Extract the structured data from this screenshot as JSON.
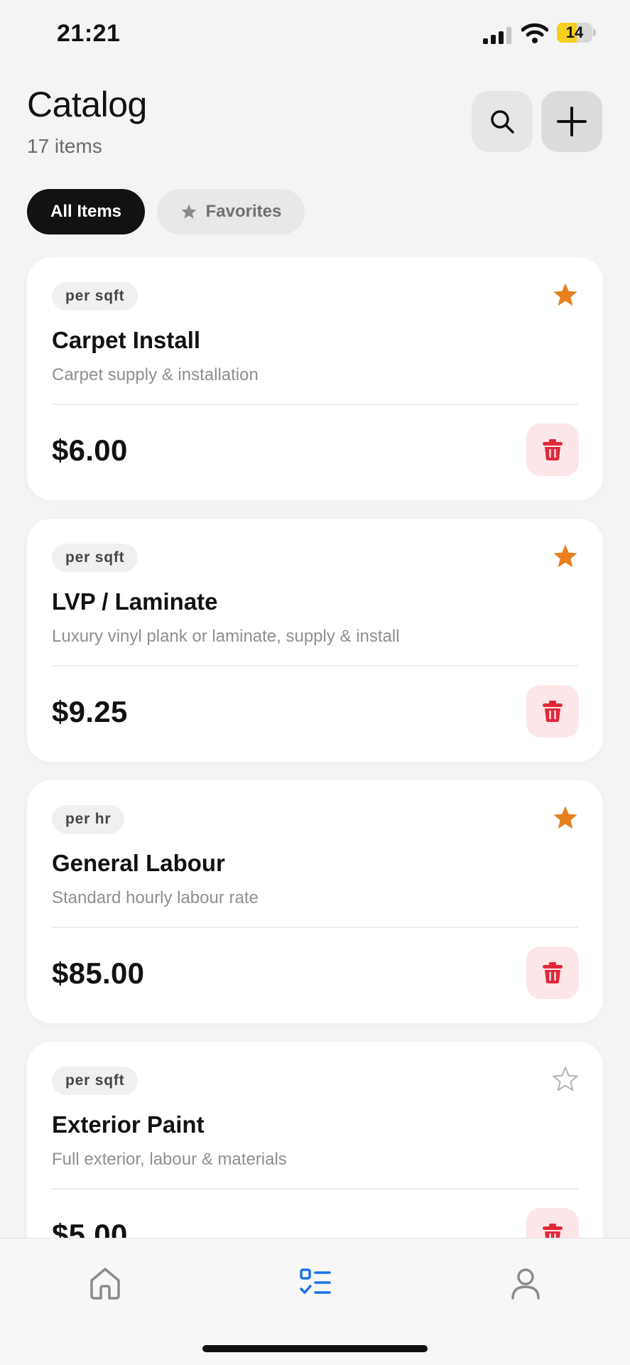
{
  "status_bar": {
    "time": "21:21",
    "battery_level": "14",
    "battery_fraction": 0.55,
    "battery_color": "#f5cf1d"
  },
  "header": {
    "title": "Catalog",
    "count": "17 items"
  },
  "tabs": [
    {
      "label": "All Items",
      "active": true
    },
    {
      "label": "Favorites",
      "active": false,
      "icon": "star-icon"
    }
  ],
  "items": [
    {
      "unit": "per sqft",
      "name": "Carpet Install",
      "description": "Carpet supply & installation",
      "price": "$6.00",
      "favorite": true
    },
    {
      "unit": "per sqft",
      "name": "LVP / Laminate",
      "description": "Luxury vinyl plank or laminate, supply & install",
      "price": "$9.25",
      "favorite": true
    },
    {
      "unit": "per hr",
      "name": "General Labour",
      "description": "Standard hourly labour rate",
      "price": "$85.00",
      "favorite": true
    },
    {
      "unit": "per sqft",
      "name": "Exterior Paint",
      "description": "Full exterior, labour & materials",
      "price": "$5.00",
      "favorite": false
    }
  ],
  "bottom_nav": [
    {
      "name": "home",
      "icon": "home-icon",
      "active": false
    },
    {
      "name": "catalog",
      "icon": "checklist-icon",
      "active": true
    },
    {
      "name": "profile",
      "icon": "person-icon",
      "active": false
    }
  ],
  "colors": {
    "accent": "#1a73e8",
    "favorite_star": "#e8801e",
    "delete": "#e0283a",
    "delete_bg": "#fde6e8"
  }
}
